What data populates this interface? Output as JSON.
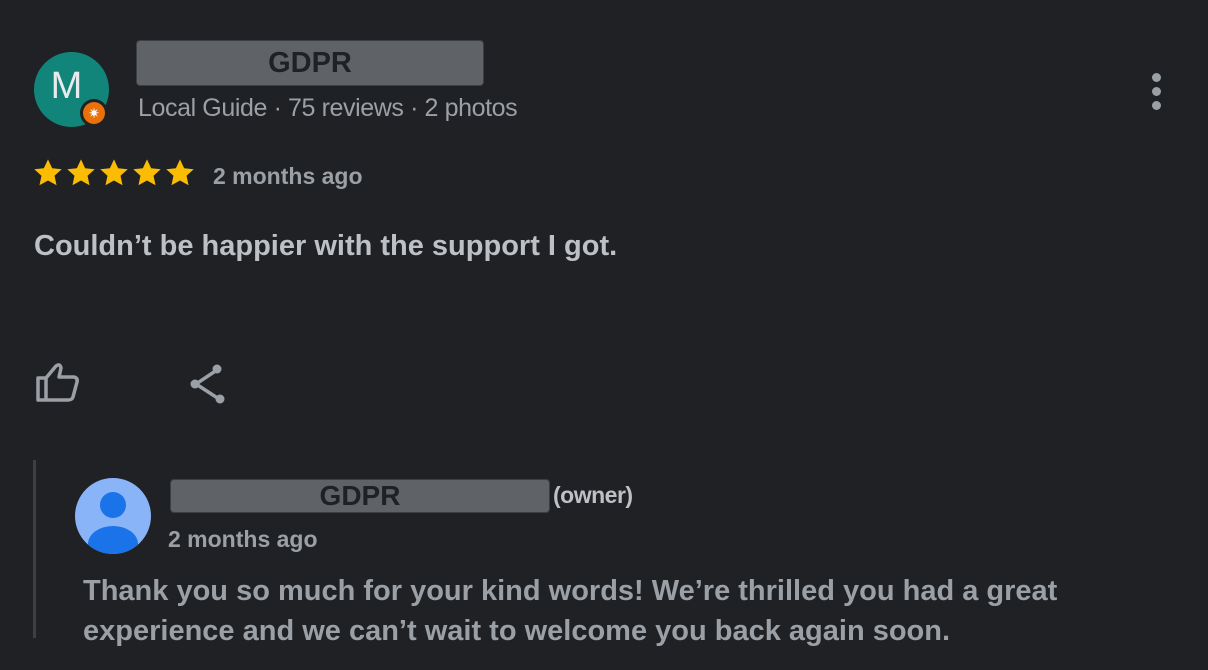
{
  "review": {
    "avatar_letter": "M",
    "reviewer_name": "GDPR",
    "reviewer_meta": "Local Guide · 75 reviews · 2 photos",
    "rating": 5,
    "rating_max": 5,
    "time": "2 months ago",
    "text": "Couldn’t be happier with the support I got.",
    "icons": [
      "local-guide-badge-icon",
      "more-options-icon",
      "star-icon",
      "thumbs-up-icon",
      "share-icon"
    ]
  },
  "reply": {
    "owner_name": "GDPR",
    "owner_tag": "(owner)",
    "time": "2 months ago",
    "text": "Thank you so much for your kind words! We’re thrilled you had a great experience and we can’t wait to welcome you back again soon.",
    "icons": [
      "default-avatar-icon"
    ]
  },
  "colors": {
    "background": "#202124",
    "avatar_main": "#12857a",
    "guide_badge": "#e8710a",
    "star": "#fbbc04",
    "owner_avatar": "#8ab4f8",
    "redaction_box": "#5f6368"
  }
}
